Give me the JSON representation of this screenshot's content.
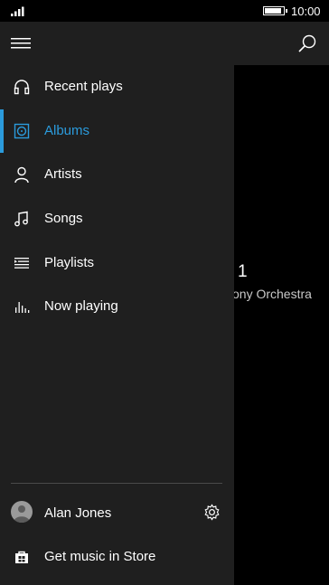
{
  "status_bar": {
    "time": "10:00",
    "battery_level": 0.9,
    "icons": [
      "signal-icon",
      "battery-icon"
    ]
  },
  "top_bar": {
    "icons": [
      "hamburger-menu-icon",
      "search-icon"
    ]
  },
  "nav": {
    "items": [
      {
        "label": "Recent plays",
        "icon": "headphones-icon",
        "active": false
      },
      {
        "label": "Albums",
        "icon": "album-icon",
        "active": true
      },
      {
        "label": "Artists",
        "icon": "person-icon",
        "active": false
      },
      {
        "label": "Songs",
        "icon": "music-note-icon",
        "active": false
      },
      {
        "label": "Playlists",
        "icon": "playlist-icon",
        "active": false
      },
      {
        "label": "Now playing",
        "icon": "equalizer-icon",
        "active": false
      }
    ]
  },
  "account": {
    "name": "Alan Jones",
    "icons": [
      "avatar",
      "gear-icon"
    ]
  },
  "store": {
    "label": "Get music in Store",
    "icon": "store-icon"
  },
  "background_content": {
    "title_fragment": "1",
    "subtitle_fragment": "ony Orchestra"
  },
  "colors": {
    "accent": "#2b9bdc",
    "drawer_bg": "#1f1f1f",
    "page_bg": "#000000"
  }
}
